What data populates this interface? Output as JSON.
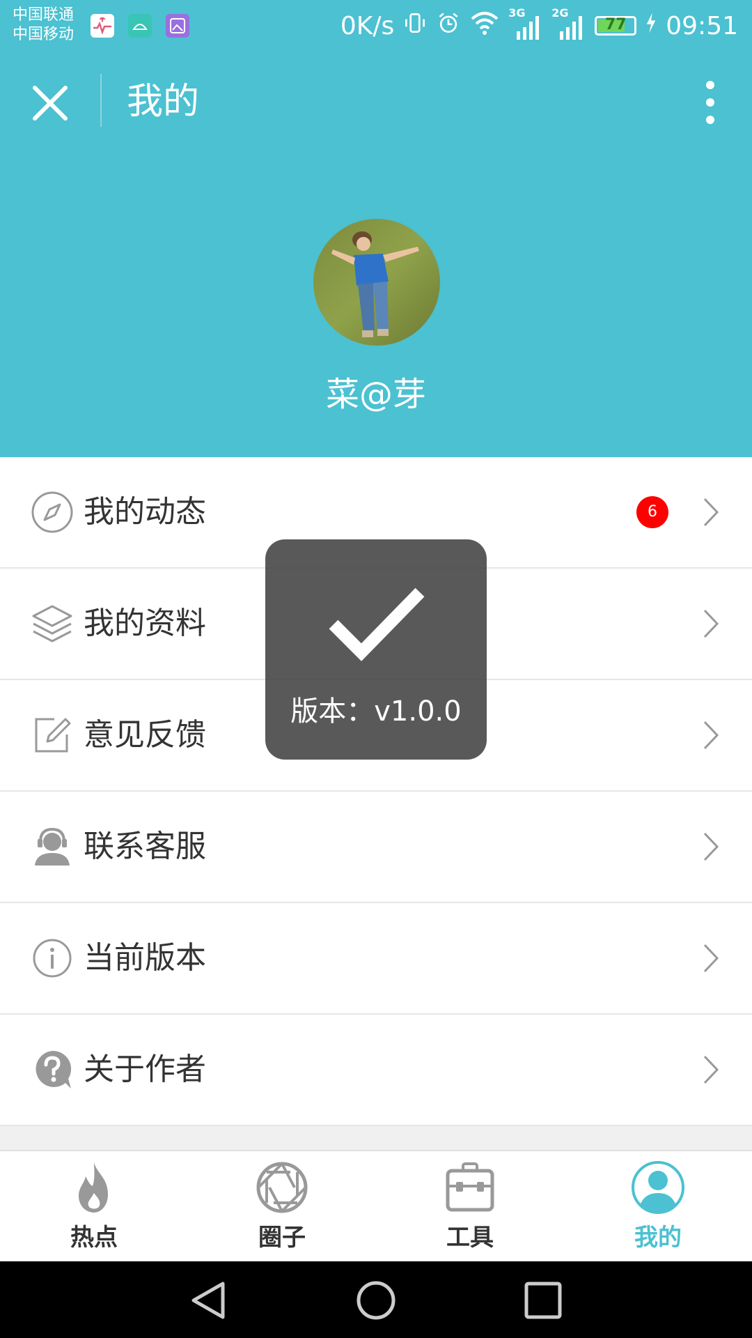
{
  "status_bar": {
    "carrier_1": "中国联通",
    "carrier_2": "中国移动",
    "net_speed": "0K/s",
    "signal_1": "3G",
    "signal_2": "2G",
    "battery_level": 77,
    "battery_text": "77",
    "time": "09:51"
  },
  "appbar": {
    "title": "我的"
  },
  "profile": {
    "username": "菜@芽"
  },
  "menu": [
    {
      "label": "我的动态",
      "icon": "compass-icon",
      "badge": "6"
    },
    {
      "label": "我的资料",
      "icon": "layers-icon"
    },
    {
      "label": "意见反馈",
      "icon": "edit-icon"
    },
    {
      "label": "联系客服",
      "icon": "headset-user-icon"
    },
    {
      "label": "当前版本",
      "icon": "info-icon"
    },
    {
      "label": "关于作者",
      "icon": "question-icon"
    }
  ],
  "toast": {
    "text": "版本：v1.0.0"
  },
  "bottom_nav": [
    {
      "label": "热点",
      "icon": "flame-icon"
    },
    {
      "label": "圈子",
      "icon": "aperture-icon"
    },
    {
      "label": "工具",
      "icon": "toolbox-icon"
    },
    {
      "label": "我的",
      "icon": "user-icon",
      "active": true
    }
  ],
  "colors": {
    "accent": "#4bc1d1",
    "badge": "#ff0000",
    "toast_bg": "#3c3c3c"
  }
}
